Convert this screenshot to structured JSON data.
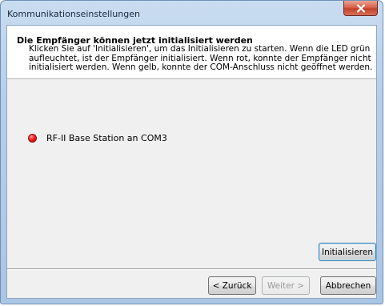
{
  "window": {
    "title": "Kommunikationseinstellungen"
  },
  "header": {
    "title": "Die Empfänger können jetzt initialisiert werden",
    "description_lines": [
      "Klicken Sie auf 'Initialisieren', um das Initialisieren zu starten. Wenn die LED grün",
      "aufleuchtet, ist der Empfänger initialisiert. Wenn rot, konnte der Empfänger nicht",
      "initialisiert werden. Wenn gelb, konnte der COM-Anschluss nicht geöffnet werden."
    ]
  },
  "receivers": [
    {
      "label": "RF-II Base Station an COM3",
      "led_color": "#e81c1c",
      "status": "red"
    }
  ],
  "buttons": {
    "initialize": "Initialisieren",
    "back": "< Zurück",
    "next": "Weiter >",
    "cancel": "Abbrechen"
  },
  "colors": {
    "titlebar": "#b9d1ea",
    "close_button": "#c7432d",
    "content_bg": "#f0f0f0",
    "header_bg": "#ffffff"
  },
  "icons": {
    "close": "close-x-icon",
    "led": "led-indicator-icon"
  }
}
